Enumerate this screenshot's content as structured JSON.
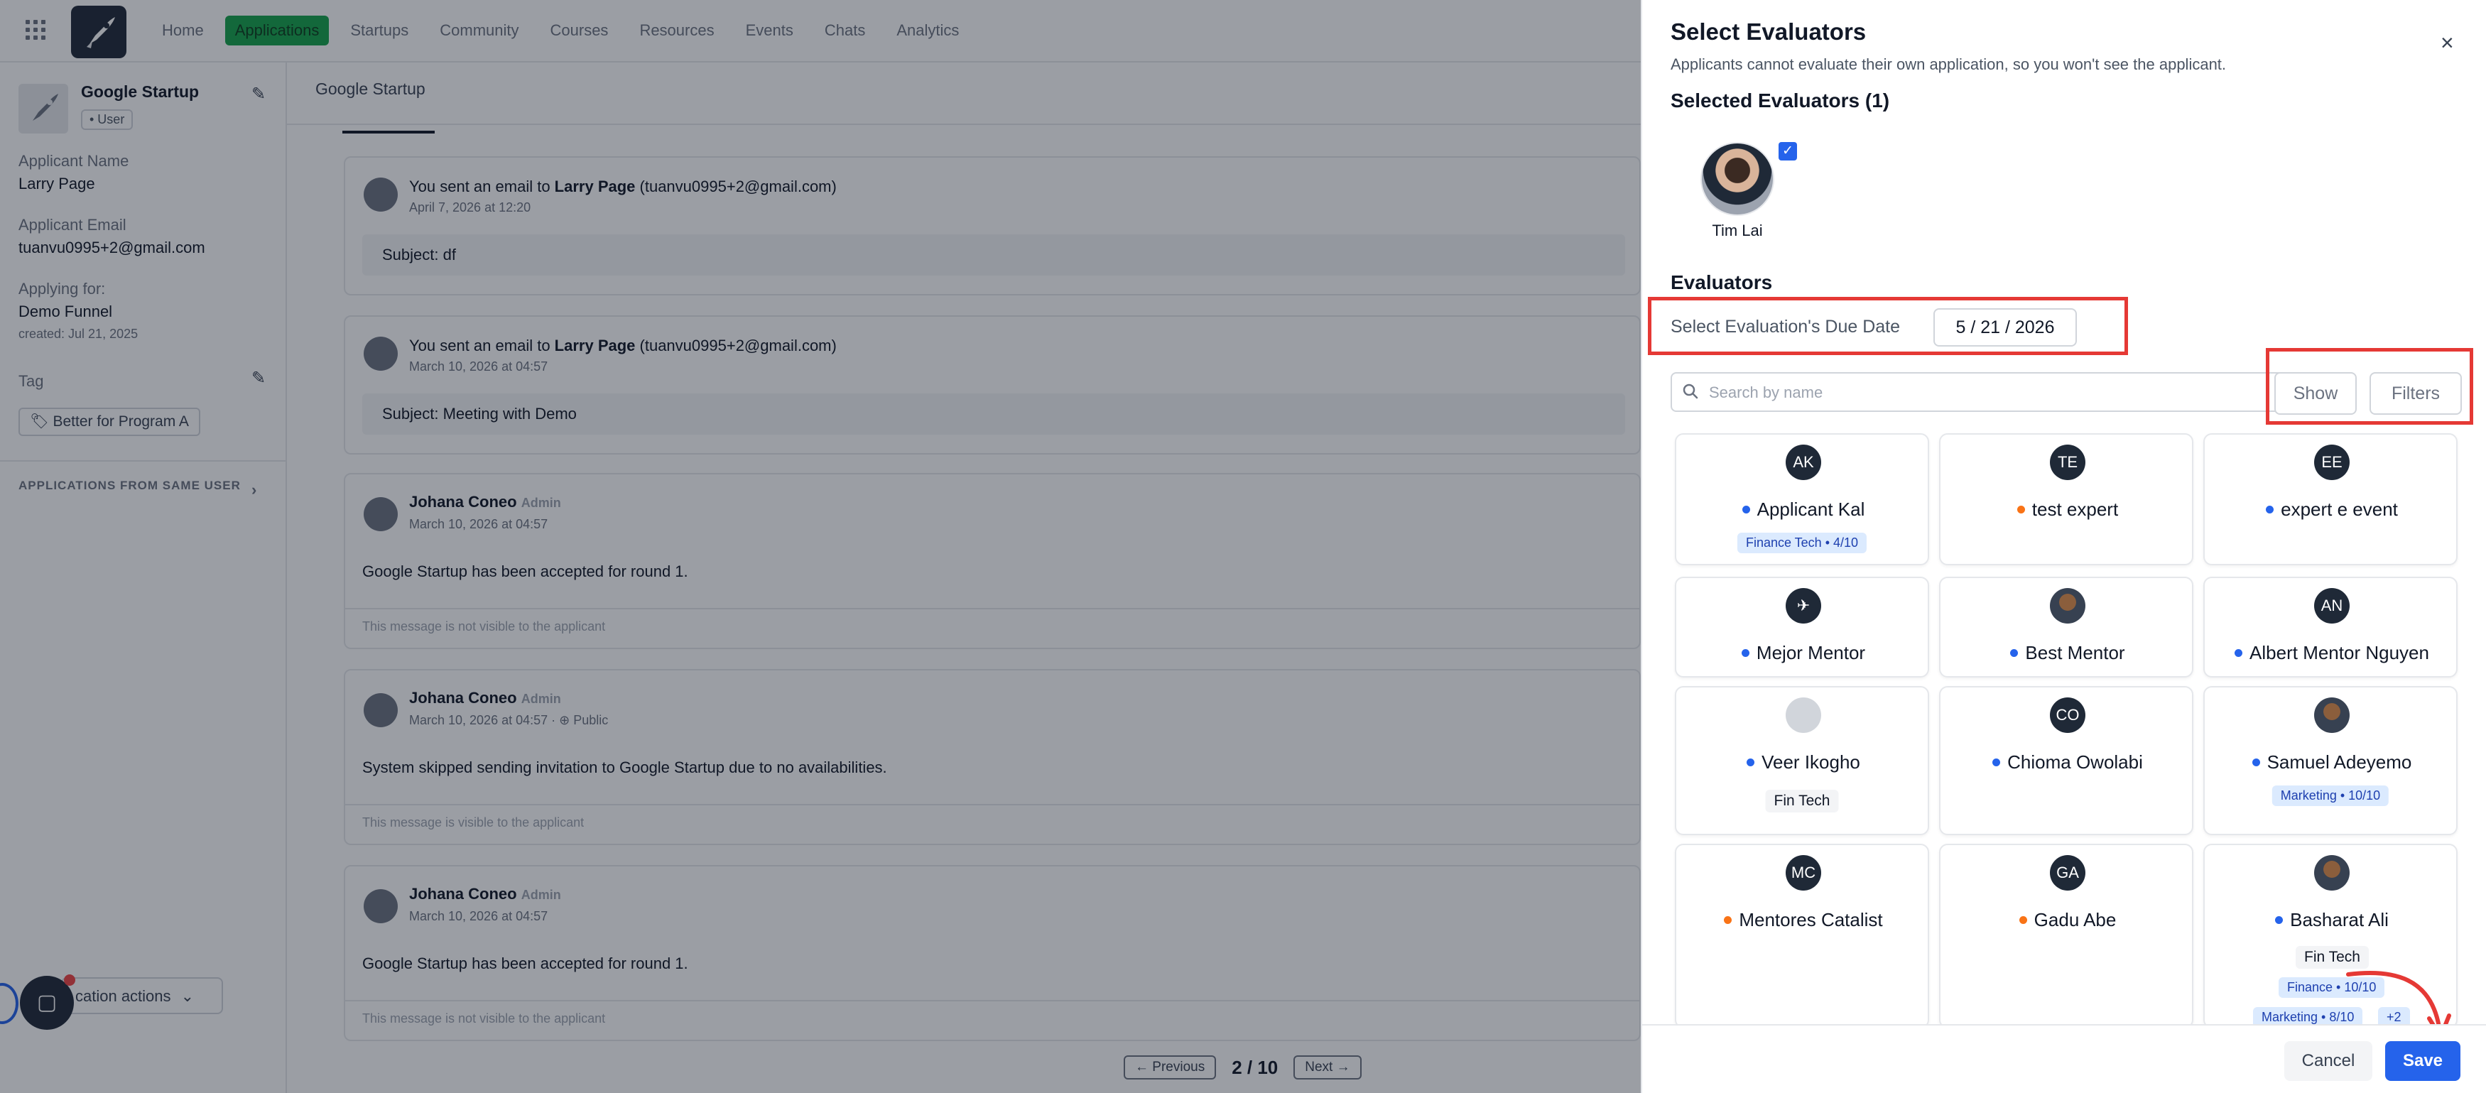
{
  "nav": {
    "items": [
      "Home",
      "Applications",
      "Startups",
      "Community",
      "Courses",
      "Resources",
      "Events",
      "Chats",
      "Analytics"
    ],
    "active": "Applications"
  },
  "applicant": {
    "title": "Google Startup",
    "role": "• User",
    "name_label": "Applicant Name",
    "name": "Larry Page",
    "email_label": "Applicant Email",
    "email": "tuanvu0995+2@gmail.com",
    "applying_label": "Applying for:",
    "applying": "Demo Funnel",
    "created": "created: Jul 21, 2025",
    "tag_label": "Tag",
    "tag": "Better for Program A",
    "same_user_section": "APPLICATIONS FROM SAME USER",
    "actions_button": "cation actions"
  },
  "main": {
    "breadcrumb": "Google Startup",
    "cards": [
      {
        "text_pre": "You sent an email to ",
        "name": "Larry Page",
        "text_post": " (tuanvu0995+2@gmail.com)",
        "date": "April 7, 2026 at 12:20",
        "subject": "Subject: df"
      },
      {
        "text_pre": "You sent an email to ",
        "name": "Larry Page",
        "text_post": " (tuanvu0995+2@gmail.com)",
        "date": "March 10, 2026 at 04:57",
        "subject": "Subject: Meeting with Demo"
      },
      {
        "author": "Johana Coneo",
        "role": "Admin",
        "date": "March 10, 2026 at 04:57",
        "body": "Google Startup has been accepted for round 1.",
        "foot": "This message is not visible to the applicant"
      },
      {
        "author": "Johana Coneo",
        "role": "Admin",
        "date": "March 10, 2026 at 04:57",
        "public": "· ⊕ Public",
        "body": "System skipped sending invitation to Google Startup due to no availabilities.",
        "foot": "This message is visible to the applicant"
      },
      {
        "author": "Johana Coneo",
        "role": "Admin",
        "date": "March 10, 2026 at 04:57",
        "body": "Google Startup has been accepted for round 1.",
        "foot": "This message is not visible to the applicant"
      }
    ],
    "pager": {
      "prev": "← Previous",
      "page": "2 / 10",
      "next": "Next →"
    }
  },
  "drawer": {
    "title": "Select Evaluators",
    "subtitle": "Applicants cannot evaluate their own application, so you won't see the applicant.",
    "selected_title": "Selected Evaluators (1)",
    "selected": [
      {
        "name": "Tim Lai",
        "checked": true
      }
    ],
    "evaluators_title": "Evaluators",
    "due_label": "Select Evaluation's Due Date",
    "due_value": "5 / 21 / 2026",
    "search_placeholder": "Search by name",
    "show_label": "Show",
    "filters_label": "Filters",
    "evaluators": [
      {
        "initials": "AK",
        "name": "Applicant Kal",
        "status": "blue",
        "tags": [
          {
            "text": "Finance Tech • 4/10",
            "style": "blue"
          }
        ]
      },
      {
        "initials": "TE",
        "name": "test expert",
        "status": "orange",
        "tags": []
      },
      {
        "initials": "EE",
        "name": "expert e event",
        "status": "blue",
        "tags": []
      },
      {
        "initials": "",
        "name": "Mejor Mentor",
        "status": "blue",
        "avatar": "logo",
        "tags": []
      },
      {
        "initials": "",
        "name": "Best Mentor",
        "status": "blue",
        "avatar": "photo",
        "tags": []
      },
      {
        "initials": "AN",
        "name": "Albert Mentor Nguyen",
        "status": "blue",
        "tags": []
      },
      {
        "initials": "",
        "name": "Veer Ikogho",
        "status": "blue",
        "avatar": "gray",
        "tags": [
          {
            "text": "Fin Tech",
            "style": "gray"
          }
        ]
      },
      {
        "initials": "CO",
        "name": "Chioma Owolabi",
        "status": "blue",
        "tags": []
      },
      {
        "initials": "",
        "name": "Samuel Adeyemo",
        "status": "blue",
        "avatar": "photo",
        "tags": [
          {
            "text": "Marketing • 10/10",
            "style": "blue"
          }
        ]
      },
      {
        "initials": "MC",
        "name": "Mentores Catalist",
        "status": "orange",
        "tags": []
      },
      {
        "initials": "GA",
        "name": "Gadu Abe",
        "status": "orange",
        "tags": []
      },
      {
        "initials": "",
        "name": "Basharat Ali",
        "status": "blue",
        "avatar": "photo",
        "tags": [
          {
            "text": "Fin Tech",
            "style": "gray"
          },
          {
            "text": "Finance • 10/10",
            "style": "blue"
          },
          {
            "text": "Marketing • 8/10",
            "style": "blue"
          },
          {
            "text": "+2",
            "style": "blue"
          }
        ]
      }
    ],
    "cancel_label": "Cancel",
    "save_label": "Save"
  }
}
